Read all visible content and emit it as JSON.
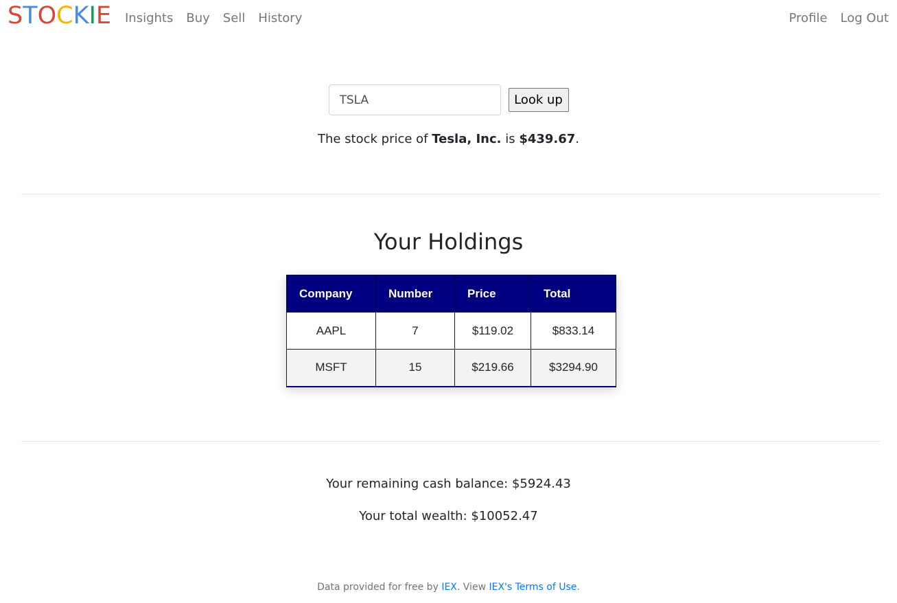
{
  "brand": {
    "letters": [
      {
        "char": "S",
        "color": "#db4437"
      },
      {
        "char": "T",
        "color": "#4a89dc"
      },
      {
        "char": "O",
        "color": "#db4437"
      },
      {
        "char": "C",
        "color": "#f4b400"
      },
      {
        "char": "K",
        "color": "#4a89dc"
      },
      {
        "char": "I",
        "color": "#0f9d58"
      },
      {
        "char": "E",
        "color": "#db4437"
      }
    ]
  },
  "nav": {
    "left": [
      "Insights",
      "Buy",
      "Sell",
      "History"
    ],
    "right": [
      "Profile",
      "Log Out"
    ]
  },
  "lookup": {
    "input_value": "TSLA",
    "button_label": "Look up"
  },
  "quote": {
    "prefix": "The stock price of ",
    "company": "Tesla, Inc.",
    "middle": " is ",
    "price": "$439.67",
    "suffix": "."
  },
  "holdings": {
    "title": "Your Holdings",
    "headers": [
      "Company",
      "Number",
      "Price",
      "Total"
    ],
    "rows": [
      [
        "AAPL",
        "7",
        "$119.02",
        "$833.14"
      ],
      [
        "MSFT",
        "15",
        "$219.66",
        "$3294.90"
      ]
    ]
  },
  "summary": {
    "cash": "Your remaining cash balance: $5924.43",
    "wealth": "Your total wealth: $10052.47"
  },
  "footer": {
    "text1": "Data provided for free by ",
    "link1": "IEX",
    "text2": ". View ",
    "link2": "IEX's Terms of Use",
    "text3": "."
  },
  "colors": {
    "table_header": "#000080",
    "link": "#007bff"
  }
}
